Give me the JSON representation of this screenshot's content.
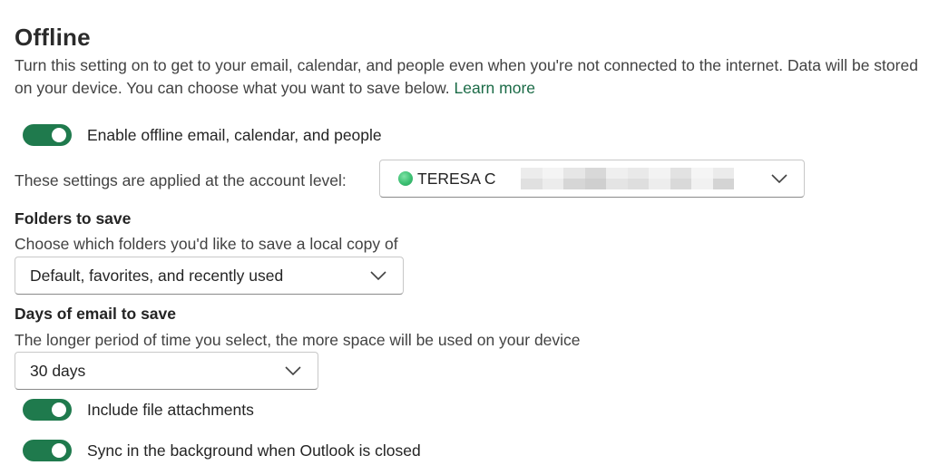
{
  "header": {
    "title": "Offline",
    "description": "Turn this setting on to get to your email, calendar, and people even when you're not connected to the internet. Data will be stored on your device. You can choose what you want to save below.",
    "learn_more": "Learn more"
  },
  "toggles": {
    "enable_offline": {
      "label": "Enable offline email, calendar, and people",
      "state": "on"
    },
    "include_attachments": {
      "label": "Include file attachments",
      "state": "on"
    },
    "sync_background": {
      "label": "Sync in the background when Outlook is closed",
      "state": "on"
    }
  },
  "account": {
    "label": "These settings are applied at the account level:",
    "selected": "TERESA C",
    "presence_color": "#3cbf72"
  },
  "folders": {
    "heading": "Folders to save",
    "subtitle": "Choose which folders you'd like to save a local copy of",
    "selected": "Default, favorites, and recently used"
  },
  "days": {
    "heading": "Days of email to save",
    "subtitle": "The longer period of time you select, the more space will be used on your device",
    "selected": "30 days"
  },
  "colors": {
    "accent": "#1f7a4d",
    "link": "#1b6b47"
  }
}
